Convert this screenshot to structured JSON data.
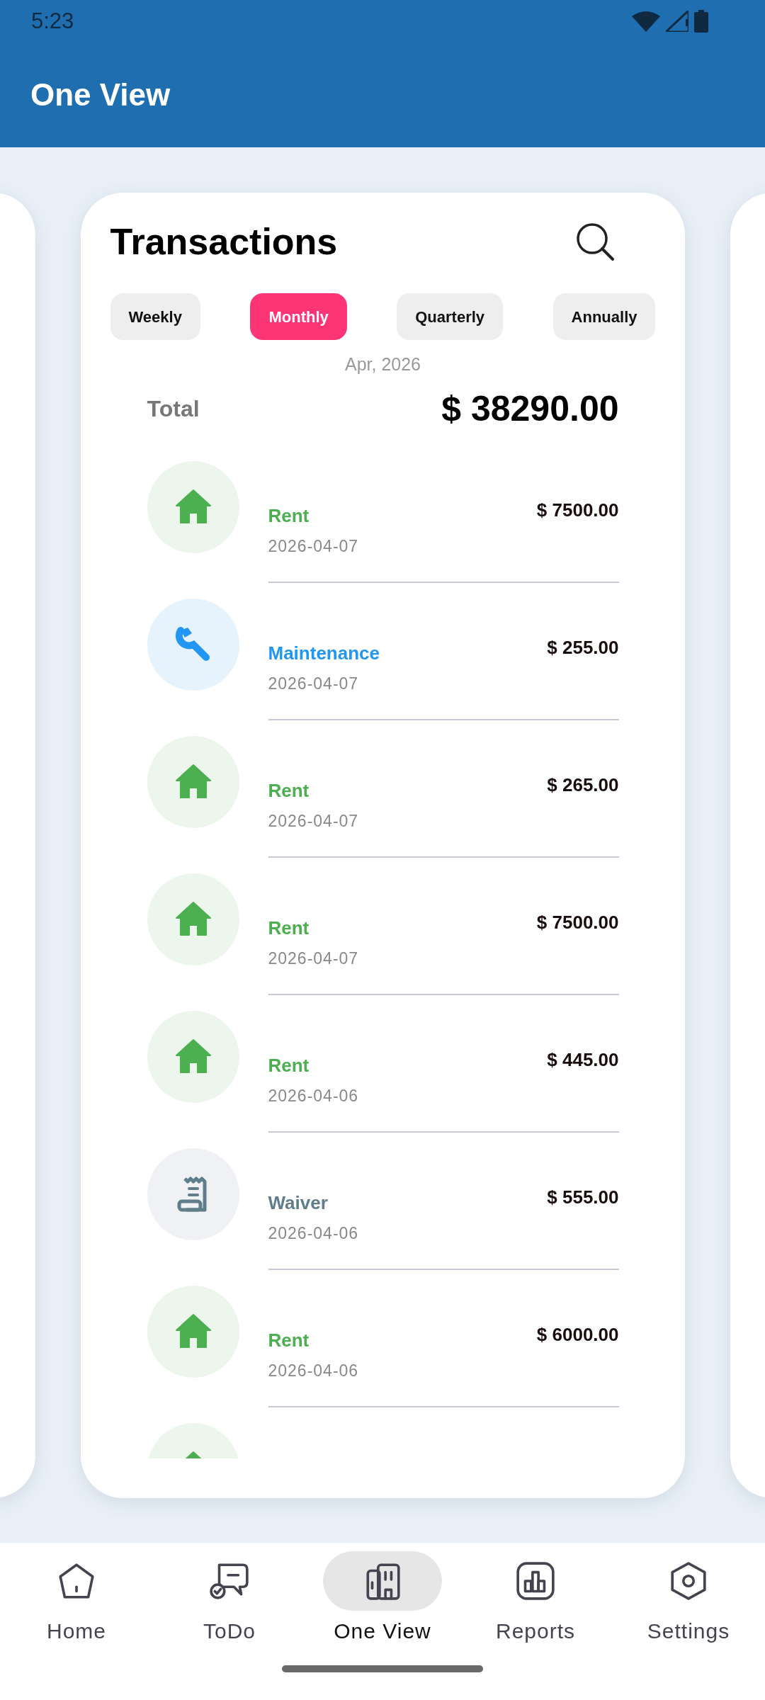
{
  "status_bar": {
    "time": "5:23"
  },
  "app_bar": {
    "title": "One View"
  },
  "card": {
    "title": "Transactions",
    "filters": [
      {
        "label": "Weekly",
        "selected": false
      },
      {
        "label": "Monthly",
        "selected": true
      },
      {
        "label": "Quarterly",
        "selected": false
      },
      {
        "label": "Annually",
        "selected": false
      }
    ],
    "period": "Apr, 2026",
    "total": {
      "label": "Total",
      "amount": "$ 38290.00"
    },
    "transactions": [
      {
        "kind": "rent",
        "label": "Rent",
        "date": "2026-04-07",
        "amount": "$ 7500.00"
      },
      {
        "kind": "maintenance",
        "label": "Maintenance",
        "date": "2026-04-07",
        "amount": "$ 255.00"
      },
      {
        "kind": "rent",
        "label": "Rent",
        "date": "2026-04-07",
        "amount": "$ 265.00"
      },
      {
        "kind": "rent",
        "label": "Rent",
        "date": "2026-04-07",
        "amount": "$ 7500.00"
      },
      {
        "kind": "rent",
        "label": "Rent",
        "date": "2026-04-06",
        "amount": "$ 445.00"
      },
      {
        "kind": "waiver",
        "label": "Waiver",
        "date": "2026-04-06",
        "amount": "$ 555.00"
      },
      {
        "kind": "rent",
        "label": "Rent",
        "date": "2026-04-06",
        "amount": "$ 6000.00"
      },
      {
        "kind": "rent"
      }
    ]
  },
  "bottom_nav": [
    {
      "kind": "home",
      "label": "Home",
      "selected": false
    },
    {
      "kind": "todo",
      "label": "ToDo",
      "selected": false
    },
    {
      "kind": "oneview",
      "label": "One View",
      "selected": true
    },
    {
      "kind": "reports",
      "label": "Reports",
      "selected": false
    },
    {
      "kind": "settings",
      "label": "Settings",
      "selected": false
    }
  ]
}
